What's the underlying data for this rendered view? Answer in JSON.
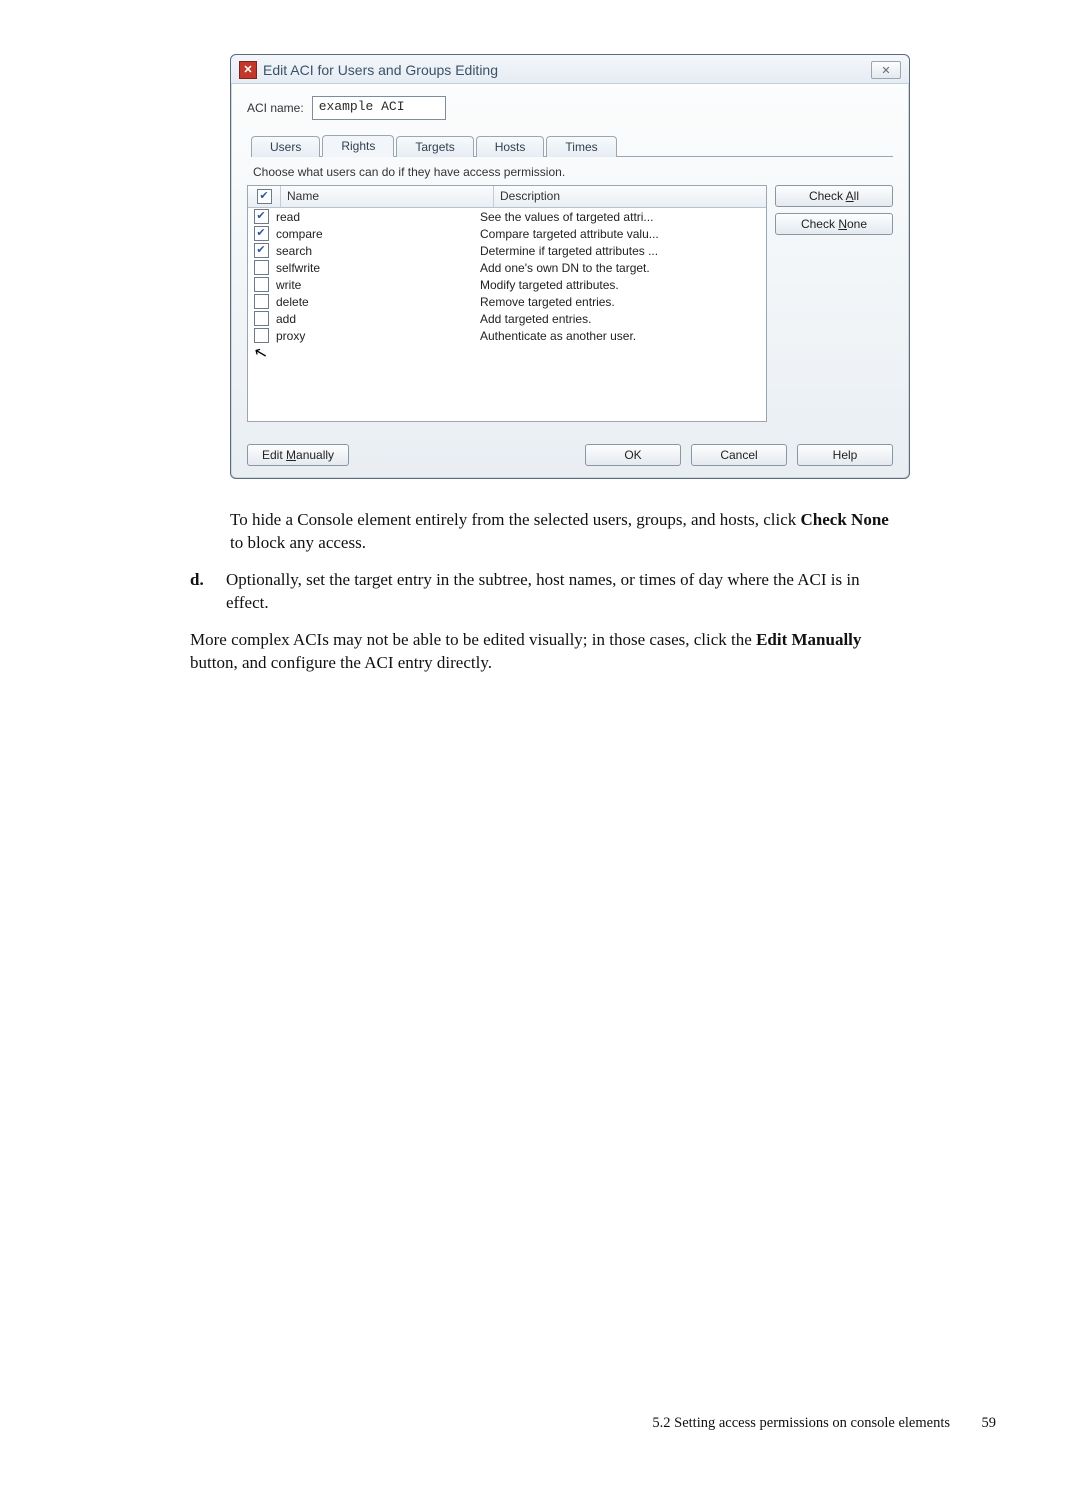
{
  "dialog": {
    "title": "Edit ACI for Users and Groups Editing",
    "aci_name_label": "ACI name:",
    "aci_name_value": "example ACI",
    "tabs": [
      "Users",
      "Rights",
      "Targets",
      "Hosts",
      "Times"
    ],
    "active_tab": 1,
    "tab_explain": "Choose what users can do if they have access permission.",
    "headers": {
      "name": "Name",
      "desc": "Description"
    },
    "rights": [
      {
        "checked": true,
        "name": "read",
        "desc": "See the values of targeted attri..."
      },
      {
        "checked": true,
        "name": "compare",
        "desc": "Compare targeted attribute valu..."
      },
      {
        "checked": true,
        "name": "search",
        "desc": "Determine if targeted attributes ..."
      },
      {
        "checked": false,
        "name": "selfwrite",
        "desc": "Add one's own DN to the target."
      },
      {
        "checked": false,
        "name": "write",
        "desc": "Modify targeted attributes."
      },
      {
        "checked": false,
        "name": "delete",
        "desc": "Remove targeted entries."
      },
      {
        "checked": false,
        "name": "add",
        "desc": "Add targeted entries."
      },
      {
        "checked": false,
        "name": "proxy",
        "desc": "Authenticate as another user."
      }
    ],
    "side_buttons": {
      "check_all": "Check All",
      "check_none": "Check None"
    },
    "footer": {
      "edit_manually": "Edit Manually",
      "ok": "OK",
      "cancel": "Cancel",
      "help": "Help"
    }
  },
  "doc": {
    "p1_a": "To hide a Console element entirely from the selected users, groups, and hosts, click ",
    "p1_b": "Check None",
    "p1_c": " to block any access.",
    "item_d_marker": "d.",
    "item_d_text": "Optionally, set the target entry in the subtree, host names, or times of day where the ACI is in effect.",
    "p2_a": "More complex ACIs may not be able to be edited visually; in those cases, click the ",
    "p2_b": "Edit Manually",
    "p2_c": " button, and configure the ACI entry directly."
  },
  "footer": {
    "section": "5.2 Setting access permissions on console elements",
    "page": "59"
  }
}
